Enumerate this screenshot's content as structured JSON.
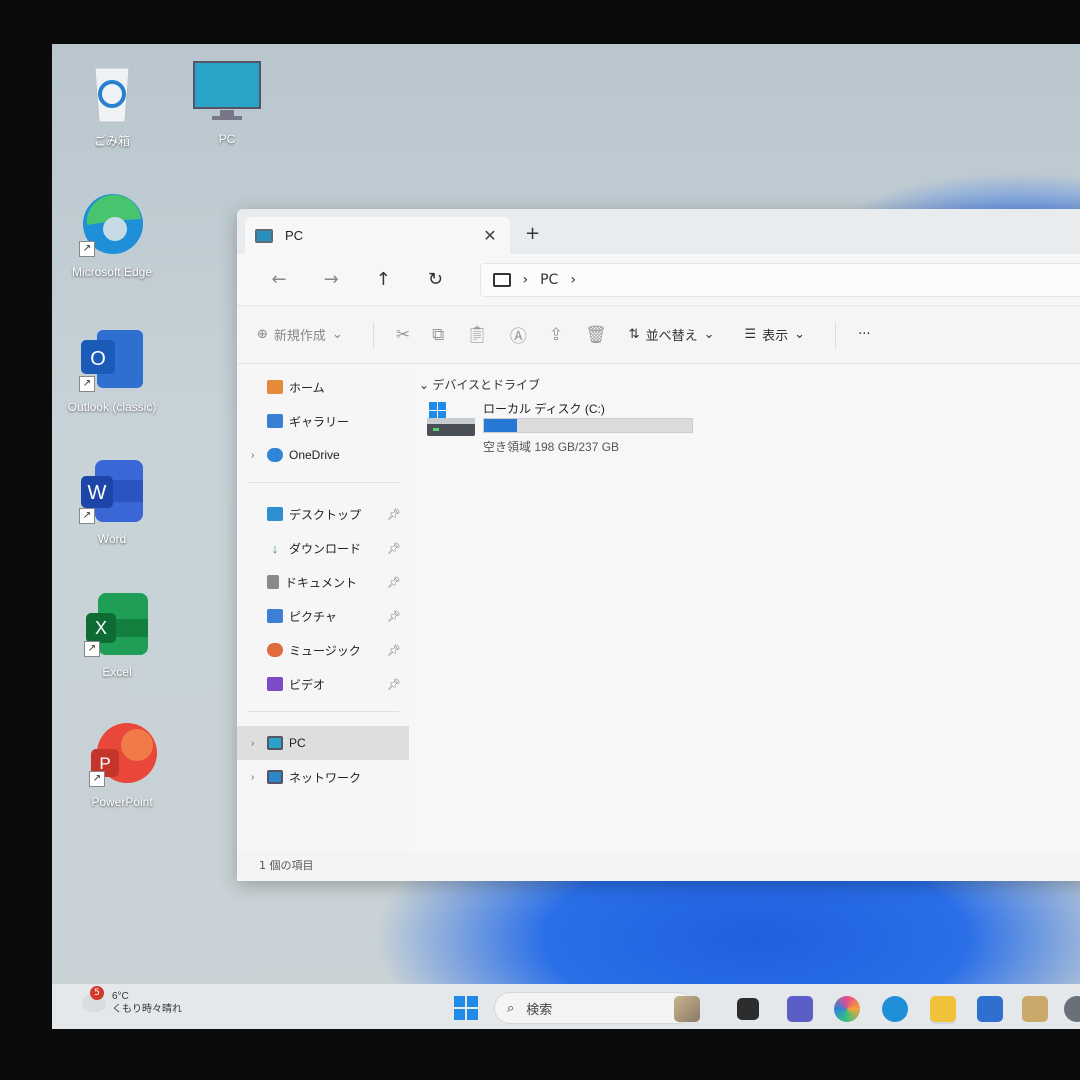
{
  "desktop": {
    "icons": [
      {
        "label": "ごみ箱",
        "icon": "recycle-bin-icon"
      },
      {
        "label": "PC",
        "icon": "monitor-icon"
      },
      {
        "label": "Microsoft Edge",
        "icon": "edge-icon"
      },
      {
        "label": "Outlook (classic)",
        "icon": "outlook-icon"
      },
      {
        "label": "Word",
        "icon": "word-icon"
      },
      {
        "label": "Excel",
        "icon": "excel-icon"
      },
      {
        "label": "PowerPoint",
        "icon": "powerpoint-icon"
      }
    ]
  },
  "window": {
    "tab_title": "PC",
    "tab_close": "✕",
    "new_tab": "+",
    "nav": {
      "back": "←",
      "forward": "→",
      "up": "↑",
      "refresh": "↻"
    },
    "address": {
      "separator": "›",
      "location": "PC",
      "trail": "›"
    },
    "toolbar": {
      "new_label": "新規作成",
      "sort_label": "並べ替え",
      "view_label": "表示",
      "more": "···"
    },
    "sidebar": {
      "home": "ホーム",
      "gallery": "ギャラリー",
      "onedrive": "OneDrive",
      "quick": [
        {
          "label": "デスクトップ",
          "color": "#2f8fd0"
        },
        {
          "label": "ダウンロード",
          "color": "#2b9a57"
        },
        {
          "label": "ドキュメント",
          "color": "#7a7a7a"
        },
        {
          "label": "ピクチャ",
          "color": "#3d7fd6"
        },
        {
          "label": "ミュージック",
          "color": "#e06b3c"
        },
        {
          "label": "ビデオ",
          "color": "#7b4bc8"
        }
      ],
      "pc": "PC",
      "network": "ネットワーク"
    },
    "content": {
      "group_title": "デバイスとドライブ",
      "drive_name": "ローカル ディスク (C:)",
      "drive_free": "空き領域 198 GB/237 GB",
      "used_fraction": 0.16
    },
    "status": "1 個の項目"
  },
  "taskbar": {
    "weather_temp": "6°C",
    "weather_desc": "くもり時々晴れ",
    "weather_badge": "5",
    "search_placeholder": "検索"
  }
}
